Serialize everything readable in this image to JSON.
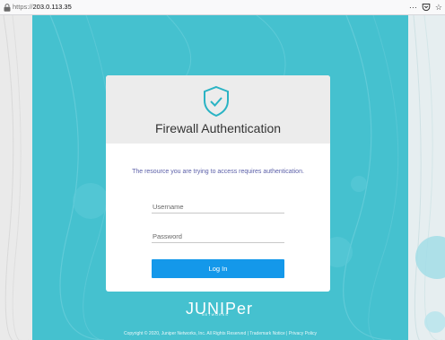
{
  "browser": {
    "url_scheme": "https://",
    "url_host": "203.0.113.35",
    "page_actions_icon": "···",
    "pocket_icon": "pocket-icon",
    "bookmark_icon": "☆"
  },
  "login_card": {
    "icon": "shield-check-icon",
    "title": "Firewall Authentication",
    "subtitle": "The resource you are trying to access requires authentication.",
    "username_placeholder": "Username",
    "username_value": "",
    "password_placeholder": "Password",
    "password_value": "",
    "login_button": "Log In"
  },
  "brand": {
    "logo_word": "JUNIPer",
    "logo_sub": "NETWORKS"
  },
  "footer": {
    "text": "Copyright © 2020, Juniper Networks, Inc.  All Rights Reserved  |  Trademark Notice  |  Privacy Policy"
  },
  "colors": {
    "background_teal": "#45c1cf",
    "accent_blue": "#1498ea",
    "shield_teal": "#2ab3c4",
    "subtitle_purple": "#5b5fa8"
  }
}
